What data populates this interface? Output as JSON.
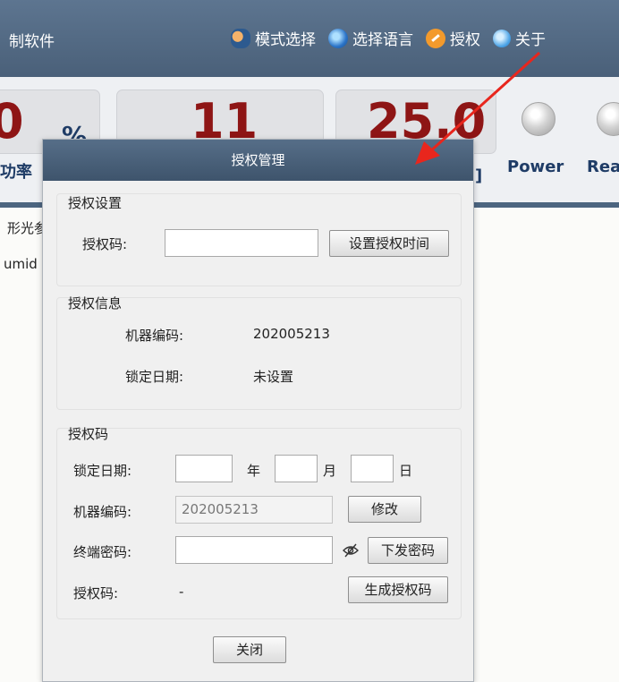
{
  "topbar": {
    "app_title": "制软件",
    "menu": [
      {
        "label": "模式选择",
        "icon": "users-icon"
      },
      {
        "label": "选择语言",
        "icon": "globe-icon"
      },
      {
        "label": "授权",
        "icon": "key-icon"
      },
      {
        "label": "关于",
        "icon": "help-icon"
      }
    ]
  },
  "stats": {
    "box1": {
      "value": "0",
      "unit": "%",
      "label": "功率"
    },
    "box2": {
      "value": "11"
    },
    "box3": {
      "value": "25.0",
      "label": "]"
    },
    "leds": [
      {
        "label": "Power"
      },
      {
        "label": "Rea"
      }
    ]
  },
  "background": {
    "frag1": "形光参",
    "frag2": "umid"
  },
  "dialog": {
    "title": "授权管理",
    "auth_settings": {
      "title": "授权设置",
      "code_label": "授权码:",
      "code_value": "",
      "set_time_button": "设置授权时间"
    },
    "auth_info": {
      "title": "授权信息",
      "machine_code_label": "机器编码:",
      "machine_code_value": "202005213",
      "lock_date_label": "锁定日期:",
      "lock_date_value": "未设置"
    },
    "auth_code": {
      "title": "授权码",
      "lock_date_label": "锁定日期:",
      "year_value": "",
      "year_unit": "年",
      "month_value": "",
      "month_unit": "月",
      "day_value": "",
      "day_unit": "日",
      "machine_code_label": "机器编码:",
      "machine_code_value": "202005213",
      "modify_button": "修改",
      "terminal_pwd_label": "终端密码:",
      "terminal_pwd_value": "",
      "send_pwd_button": "下发密码",
      "auth_code_label": "授权码:",
      "auth_code_value": "-",
      "generate_button": "生成授权码"
    },
    "close_button": "关闭"
  },
  "colors": {
    "header_blue": "#4a6079",
    "stat_red": "#8e1515",
    "stat_label_blue": "#1f3c66",
    "annotation_red": "#e8261d"
  }
}
